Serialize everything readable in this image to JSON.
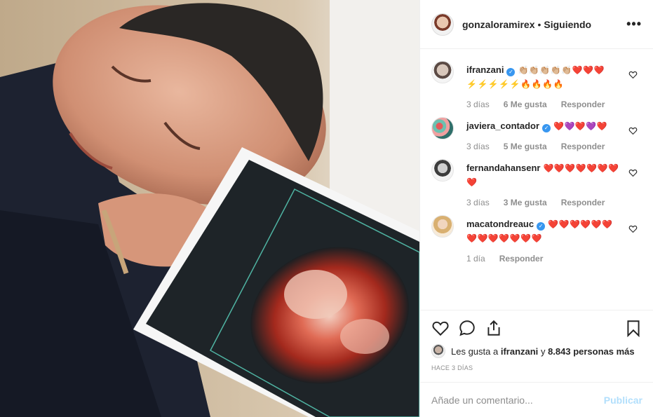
{
  "post": {
    "author": "gonzaloramirex",
    "separator": "•",
    "follow_status": "Siguiendo",
    "more": "•••"
  },
  "comments": [
    {
      "user": "ifranzani",
      "verified": true,
      "text": "👏🏼👏🏼👏🏼👏🏼👏🏼❤️❤️❤️⚡️⚡️⚡️⚡️⚡️🔥🔥🔥🔥",
      "age": "3 días",
      "likes": "6 Me gusta",
      "reply": "Responder"
    },
    {
      "user": "javiera_contador",
      "verified": true,
      "text": "❤️💜❤️💜❤️",
      "age": "3 días",
      "likes": "5 Me gusta",
      "reply": "Responder"
    },
    {
      "user": "fernandahansenr",
      "verified": false,
      "text": "❤️❤️❤️❤️❤️❤️❤️❤️",
      "age": "3 días",
      "likes": "3 Me gusta",
      "reply": "Responder"
    },
    {
      "user": "macatondreauc",
      "verified": true,
      "text": "❤️❤️❤️❤️❤️❤️❤️❤️❤️❤️❤️❤️❤️",
      "age": "1 día",
      "likes": "",
      "reply": "Responder"
    }
  ],
  "likes": {
    "prefix": "Les gusta a",
    "first_user": "ifranzani",
    "connector": "y",
    "others": "8.843 personas más"
  },
  "timestamp": "HACE 3 DÍAS",
  "composer": {
    "placeholder": "Añade un comentario...",
    "publish": "Publicar"
  },
  "colors": {
    "accent": "#3897f0",
    "publish_disabled": "#b2dffc",
    "meta_gray": "#8e8e8e"
  },
  "icons": [
    "heart-icon",
    "comment-icon",
    "share-icon",
    "bookmark-icon",
    "more-icon",
    "verified-icon"
  ]
}
